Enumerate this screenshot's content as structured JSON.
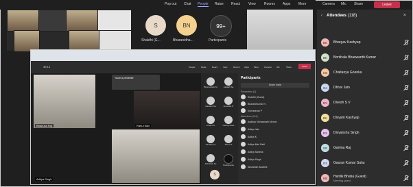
{
  "toolbar": {
    "items": [
      "Pop out",
      "Chat",
      "People",
      "Raise",
      "React",
      "View",
      "Rooms",
      "Apps",
      "More",
      "Camera",
      "Mic",
      "Share"
    ],
    "leave_label": "Leave"
  },
  "stage": {
    "avatars": [
      {
        "initials": "S",
        "label": "Shakthi (G...",
        "color": "#e9d9c8"
      },
      {
        "initials": "BN",
        "label": "Bharanidha...",
        "color": "#f4d18e"
      },
      {
        "initials": "99+",
        "label": "Participants",
        "color": "#333333"
      }
    ]
  },
  "inner_window": {
    "teams_items": [
      "People",
      "Raise",
      "React",
      "View",
      "Rooms",
      "Apps",
      "More",
      "Camera",
      "Mic",
      "Share",
      "Leave"
    ],
    "timer": "39:14",
    "notice_title": "Youre a presenter",
    "participants_title": "Participants",
    "share_invite": "Share invite",
    "presenters_label": "Presenters (3)",
    "attendees_label": "Attendees (116)",
    "small_list": [
      "Shakthi (Guest)",
      "BharaniKumar N",
      "Kumaravan P",
      "Aadhya Vishwanath Menon",
      "Aditya Jain",
      "Aditya K",
      "Aditya Mini Patil",
      "Aditya Saxena",
      "Aditya Singh",
      "Akshansh Awasthi"
    ],
    "video_labels": [
      "Bhanuka Raj",
      "Rahul Nair",
      "Aditya Singh"
    ],
    "mid_labels": [
      "Bhumanshu M",
      "Aakash Sa",
      "Gautam Gu",
      "Anushka N",
      "Arnav Ku",
      "Neeraj Sood",
      "Sandeep K",
      "Shruti S",
      "Abhishek Se",
      "Participants"
    ]
  },
  "attendees_panel": {
    "title": "Attendees",
    "count": "(118)",
    "people": [
      {
        "initials": "BK",
        "name": "Bhargav Kashyap",
        "color": "#f2b6b6",
        "sub": ""
      },
      {
        "initials": "BK",
        "name": "Bonthala Bhaswanth Kumar",
        "color": "#cfe3c8",
        "sub": ""
      },
      {
        "initials": "CG",
        "name": "Chaitanya Goenka",
        "color": "#f4c7a1",
        "sub": ""
      },
      {
        "initials": "DJ",
        "name": "Dhruv Jain",
        "color": "#c9d7f2",
        "sub": ""
      },
      {
        "initials": "DV",
        "name": "Divesh S V",
        "color": "#f0b0c8",
        "sub": ""
      },
      {
        "initials": "DK",
        "name": "Divyam Kashyap",
        "color": "#f7df9c",
        "sub": ""
      },
      {
        "initials": "DS",
        "name": "Divyanshu Singh",
        "color": "#e7c1f0",
        "sub": ""
      },
      {
        "initials": "GR",
        "name": "Garima Raj",
        "color": "#bfe1e5",
        "sub": ""
      },
      {
        "initials": "GS",
        "name": "Gaurav Kumar Sahu",
        "color": "#d6d6f2",
        "sub": ""
      },
      {
        "initials": "HB",
        "name": "Hardik Bhatia (Guest)",
        "color": "#f2b6b6",
        "sub": "Meeting guest"
      }
    ]
  }
}
